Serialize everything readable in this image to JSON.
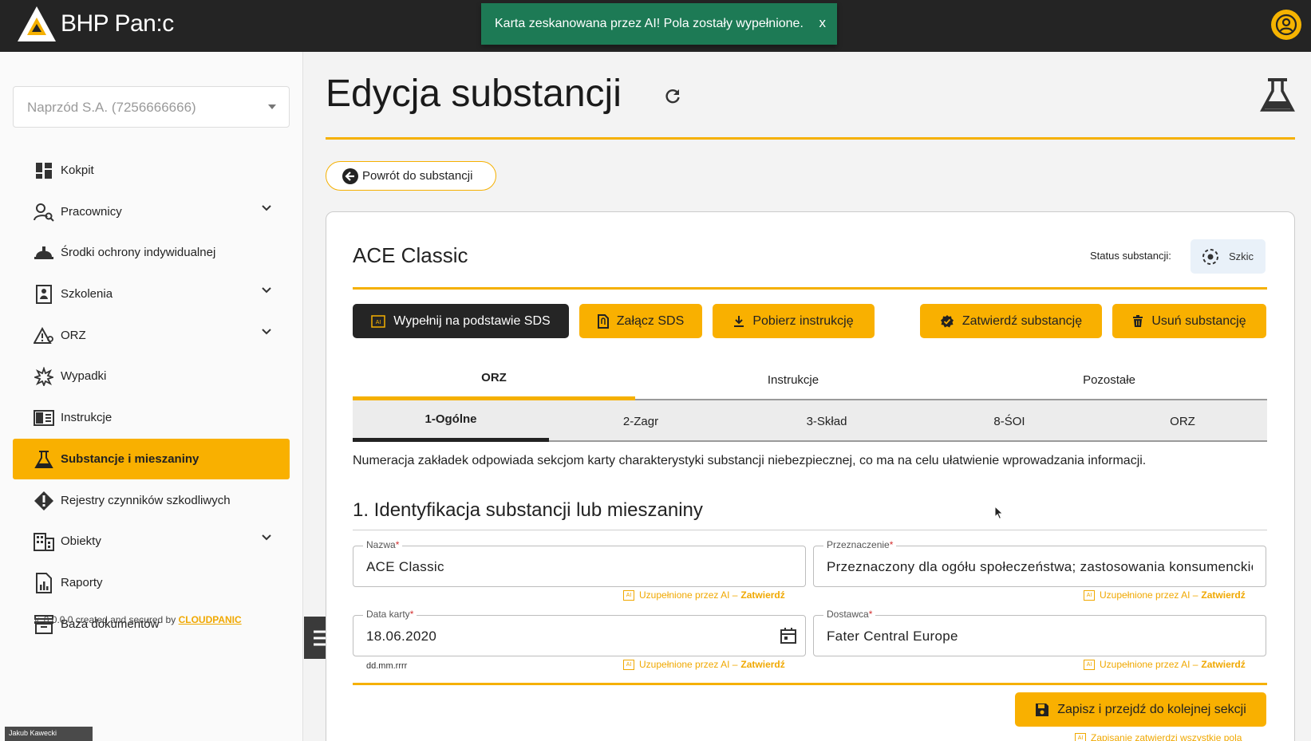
{
  "app": {
    "brand": "BHP Pan:c"
  },
  "toast": {
    "message": "Karta zeskanowana przez AI! Pola zostały wypełnione.",
    "close": "x"
  },
  "sidebar": {
    "company": "Naprzód S.A. (7256666666)",
    "items": [
      {
        "label": "Kokpit",
        "icon": "dashboard-icon"
      },
      {
        "label": "Pracownicy",
        "icon": "people-search-icon",
        "expandable": true
      },
      {
        "label": "Środki ochrony indywidualnej",
        "icon": "helmet-icon"
      },
      {
        "label": "Szkolenia",
        "icon": "training-icon",
        "expandable": true
      },
      {
        "label": "ORZ",
        "icon": "warning-icon",
        "expandable": true
      },
      {
        "label": "Wypadki",
        "icon": "accident-icon"
      },
      {
        "label": "Instrukcje",
        "icon": "book-icon"
      },
      {
        "label": "Substancje i mieszaniny",
        "icon": "flask-icon",
        "active": true
      },
      {
        "label": "Rejestry czynników szkodliwych",
        "icon": "hazard-icon"
      },
      {
        "label": "Obiekty",
        "icon": "building-icon",
        "expandable": true
      },
      {
        "label": "Raporty",
        "icon": "report-icon"
      },
      {
        "label": "Baza dokumentów",
        "icon": "archive-icon"
      }
    ],
    "version_prefix": "v. 0.0.0.0 created and secured by",
    "version_brand": "CLOUDPANIC"
  },
  "page": {
    "title": "Edycja substancji",
    "back": "Powrót do substancji",
    "substance_name": "ACE Classic",
    "status_label": "Status substancji:",
    "status_value": "Szkic"
  },
  "actions": {
    "fill_sds": "Wypełnij na podstawie SDS",
    "attach_sds": "Załącz SDS",
    "download": "Pobierz instrukcję",
    "approve": "Zatwierdź substancję",
    "delete": "Usuń substancję"
  },
  "tabs": [
    "ORZ",
    "Instrukcje",
    "Pozostałe"
  ],
  "subtabs": [
    "1-Ogólne",
    "2-Zagr",
    "3-Skład",
    "8-ŚOI",
    "ORZ"
  ],
  "info_text": "Numeracja zakładek odpowiada sekcjom karty charakterystyki substancji niebezpiecznej, co ma na celu ułatwienie wprowadzania informacji.",
  "section_title": "1. Identyfikacja substancji lub mieszaniny",
  "fields": {
    "nazwa": {
      "label": "Nazwa",
      "value": "ACE Classic"
    },
    "przeznaczenie": {
      "label": "Przeznaczenie",
      "value": "Przeznaczony dla ogółu społeczeństwa; zastosowania konsumenckie"
    },
    "data_karty": {
      "label": "Data karty",
      "value": "18.06.2020",
      "hint": "dd.mm.rrrr"
    },
    "dostawca": {
      "label": "Dostawca",
      "value": "Fater Central Europe"
    }
  },
  "ai_note": {
    "ai": "AI",
    "text": "Uzupełnione przez AI –",
    "link": "Zatwierdź"
  },
  "save": {
    "label": "Zapisz i przejdź do kolejnej sekcji",
    "note": "Zapisanie zatwierdzi wszystkie pola"
  },
  "user_tag": "Jakub Kawecki"
}
